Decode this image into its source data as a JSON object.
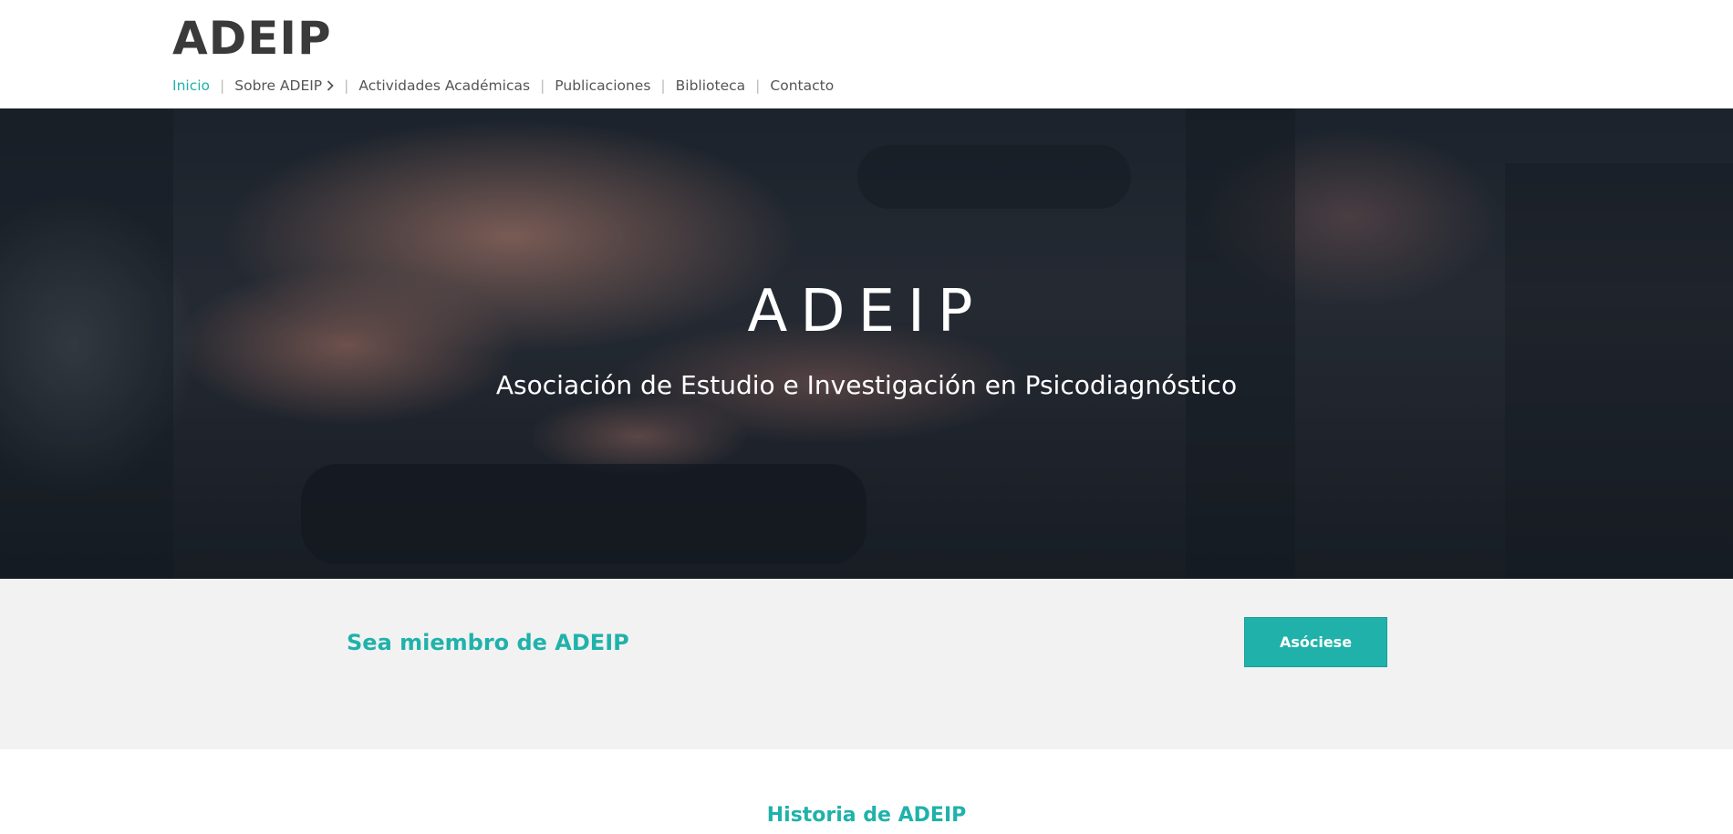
{
  "header": {
    "logo": "ADEIP",
    "nav": [
      {
        "label": "Inicio",
        "active": true
      },
      {
        "label": "Sobre ADEIP",
        "has_submenu": true
      },
      {
        "label": "Actividades Académicas"
      },
      {
        "label": "Publicaciones"
      },
      {
        "label": "Biblioteca"
      },
      {
        "label": "Contacto"
      }
    ],
    "nav_separator": "|"
  },
  "hero": {
    "title": "ADEIP",
    "subtitle": "Asociación de Estudio e Investigación en Psicodiagnóstico"
  },
  "membership": {
    "title": "Sea miembro de ADEIP",
    "button_label": "Asóciese"
  },
  "history": {
    "title": "Historia de ADEIP"
  },
  "colors": {
    "accent": "#20b2aa",
    "text": "#3a3a3a",
    "band_background": "#f2f2f2"
  },
  "icons": {
    "submenu": "chevron-right-icon"
  }
}
